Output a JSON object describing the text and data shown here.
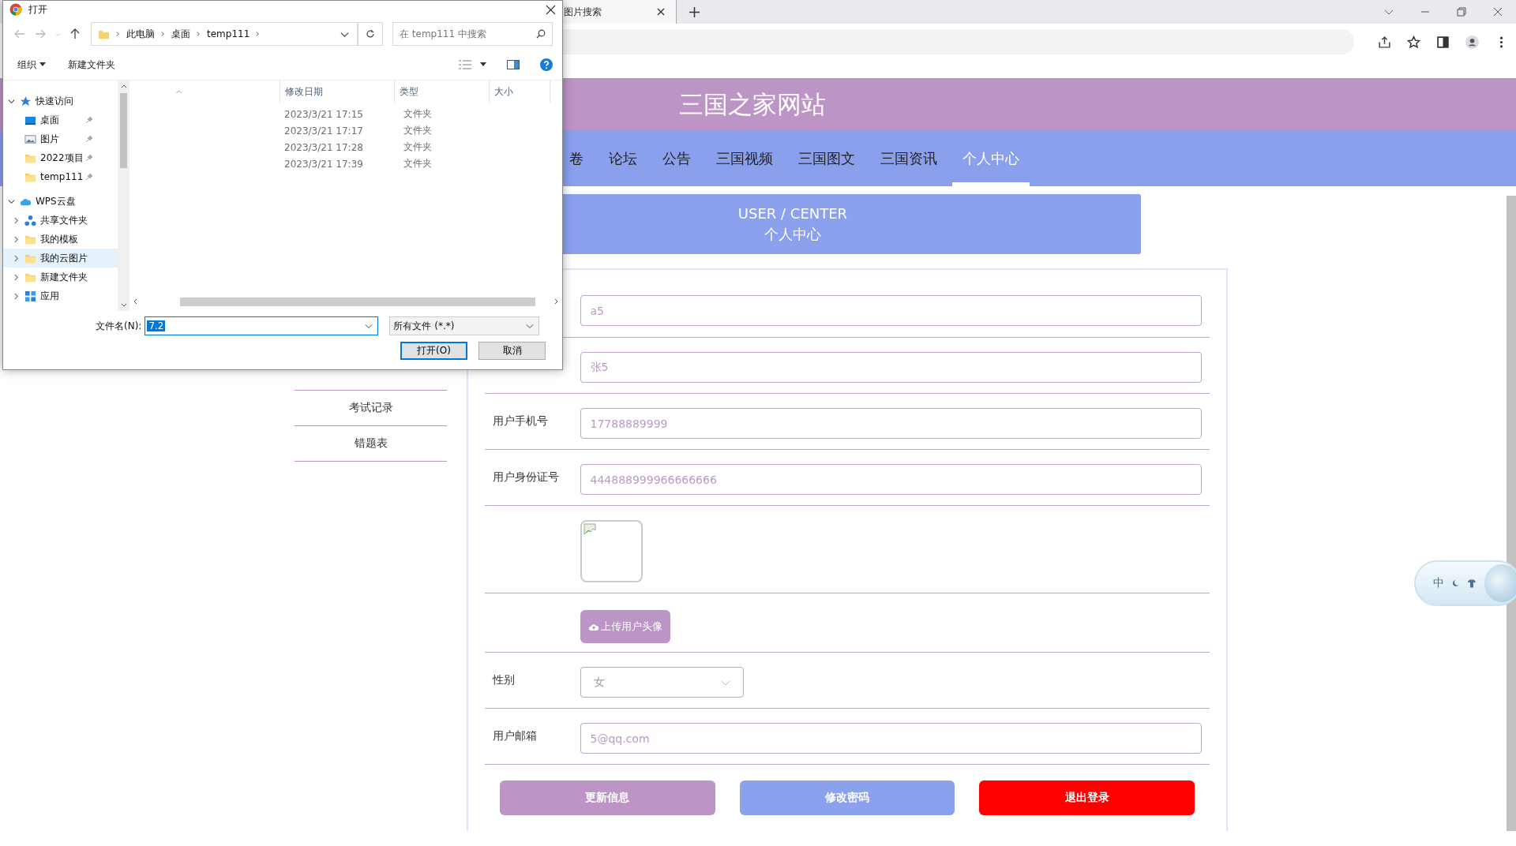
{
  "browser": {
    "tab": {
      "title": "图片搜索"
    }
  },
  "dialog": {
    "title": "打开",
    "breadcrumb": [
      "此电脑",
      "桌面",
      "temp111"
    ],
    "search": {
      "placeholder": "在 temp111 中搜索"
    },
    "toolbar": {
      "organize": "组织",
      "new_folder": "新建文件夹"
    },
    "tree": [
      {
        "label": "快速访问",
        "kind": "star",
        "expanded": true,
        "selected": false,
        "children": [
          {
            "label": "桌面",
            "kind": "desktop",
            "pinned": true,
            "selected": false
          },
          {
            "label": "图片",
            "kind": "pictures",
            "pinned": true,
            "selected": false
          },
          {
            "label": "2022项目",
            "kind": "folder",
            "pinned": true,
            "selected": false
          },
          {
            "label": "temp111",
            "kind": "folder",
            "pinned": true,
            "selected": false
          }
        ]
      },
      {
        "label": "WPS云盘",
        "kind": "cloud",
        "expanded": true,
        "selected": false,
        "children": [
          {
            "label": "共享文件夹",
            "kind": "share",
            "expanded": false,
            "selected": false
          },
          {
            "label": "我的模板",
            "kind": "folder",
            "expanded": false,
            "selected": false
          },
          {
            "label": "我的云图片",
            "kind": "folder",
            "expanded": false,
            "selected": true
          },
          {
            "label": "新建文件夹",
            "kind": "folder",
            "expanded": false,
            "selected": false
          },
          {
            "label": "应用",
            "kind": "apps",
            "expanded": false,
            "selected": false
          }
        ]
      }
    ],
    "columns": [
      "修改日期",
      "类型",
      "大小"
    ],
    "rows": [
      {
        "modified": "2023/3/21 17:15",
        "type": "文件夹"
      },
      {
        "modified": "2023/3/21 17:17",
        "type": "文件夹"
      },
      {
        "modified": "2023/3/21 17:28",
        "type": "文件夹"
      },
      {
        "modified": "2023/3/21 17:39",
        "type": "文件夹"
      }
    ],
    "filename": {
      "label": "文件名(N):",
      "value": "7.2",
      "selected": true
    },
    "filter": "所有文件 (*.*)",
    "buttons": [
      {
        "label": "打开(O)",
        "default": true
      },
      {
        "label": "取消",
        "default": false
      }
    ]
  },
  "site": {
    "title": "三国之家网站",
    "nav": [
      {
        "label": "卷",
        "selected": false
      },
      {
        "label": "论坛",
        "selected": false
      },
      {
        "label": "公告",
        "selected": false
      },
      {
        "label": "三国视频",
        "selected": false
      },
      {
        "label": "三国图文",
        "selected": false
      },
      {
        "label": "三国资讯",
        "selected": false
      },
      {
        "label": "个人中心",
        "selected": true
      }
    ],
    "banner": {
      "en": "USER / CENTER",
      "zh": "个人中心"
    },
    "side_menu": [
      "考试记录",
      "错题表"
    ],
    "form": [
      {
        "kind": "input",
        "value": "a5"
      },
      {
        "kind": "input",
        "value": "张5"
      },
      {
        "kind": "input",
        "label": "用户手机号",
        "value": "17788889999"
      },
      {
        "kind": "input",
        "label": "用户身份证号",
        "value": "444888999966666666"
      },
      {
        "kind": "avatar"
      },
      {
        "kind": "upload",
        "button": "上传用户头像"
      },
      {
        "kind": "select",
        "label": "性别",
        "value": "女"
      },
      {
        "kind": "input",
        "label": "用户邮箱",
        "value": "5@qq.com"
      }
    ],
    "buttons": [
      {
        "label": "更新信息",
        "color": "#bc94c6"
      },
      {
        "label": "修改密码",
        "color": "#8ca1ee"
      },
      {
        "label": "退出登录",
        "color": "#ff0000"
      }
    ]
  },
  "ime": {
    "label": "中"
  }
}
